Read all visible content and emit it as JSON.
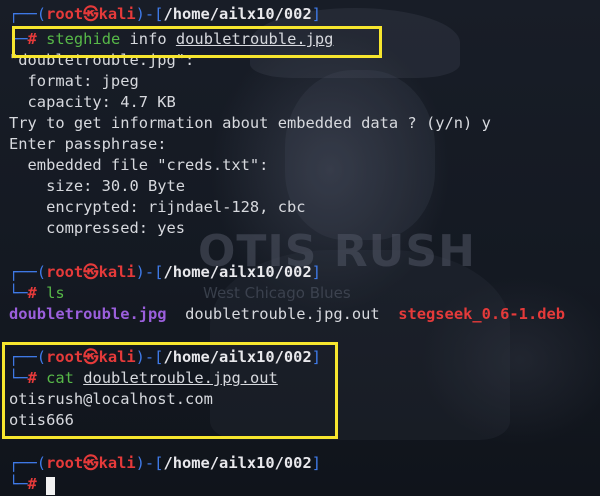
{
  "wallpaper": {
    "title": "OTIS RUSH",
    "subtitle": "West Chicago Blues"
  },
  "prompt": {
    "user": "root",
    "separator": "㉿",
    "host": "kali",
    "path": "/home/ailx10/002",
    "symbol": "#"
  },
  "block1": {
    "command": "steghide",
    "args": "info",
    "file": "doubletrouble.jpg",
    "output": [
      "\"doubletrouble.jpg\":",
      "  format: jpeg",
      "  capacity: 4.7 KB",
      "Try to get information about embedded data ? (y/n) y",
      "Enter passphrase:",
      "  embedded file \"creds.txt\":",
      "    size: 30.0 Byte",
      "    encrypted: rijndael-128, cbc",
      "    compressed: yes"
    ]
  },
  "block2": {
    "command": "ls",
    "files": {
      "dir": "doubletrouble.jpg",
      "file": "doubletrouble.jpg.out",
      "package": "stegseek_0.6-1.deb"
    }
  },
  "block3": {
    "command": "cat",
    "file": "doubletrouble.jpg.out",
    "output": [
      "otisrush@localhost.com",
      "otis666"
    ]
  },
  "colors": {
    "background": "#141922",
    "prompt_frame": "#3f7ae8",
    "user_host": "#e53a3a",
    "command": "#57b848",
    "directory": "#9b5fdc",
    "highlight": "#f7e62e"
  }
}
